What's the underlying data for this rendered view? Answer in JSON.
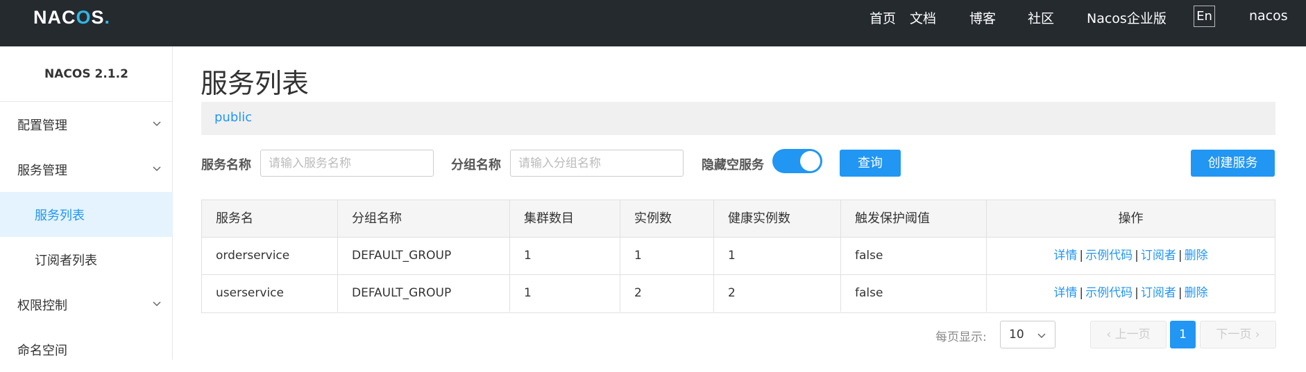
{
  "brand": {
    "logo_text_main": "NAC",
    "logo_text_mid": "O",
    "logo_text_end": "S",
    "logo_dot": "."
  },
  "topnav": {
    "items": [
      "首页",
      "文档",
      "博客",
      "社区",
      "Nacos企业版"
    ],
    "lang": "En",
    "user": "nacos"
  },
  "sidebar": {
    "version": "NACOS 2.1.2",
    "items": [
      {
        "label": "配置管理",
        "expandable": true
      },
      {
        "label": "服务管理",
        "expandable": true
      },
      {
        "label": "服务列表",
        "active": true
      },
      {
        "label": "订阅者列表"
      },
      {
        "label": "权限控制",
        "expandable": true
      },
      {
        "label": "命名空间"
      }
    ]
  },
  "page": {
    "title": "服务列表",
    "namespace": "public"
  },
  "filters": {
    "service_name_label": "服务名称",
    "service_name_placeholder": "请输入服务名称",
    "group_name_label": "分组名称",
    "group_name_placeholder": "请输入分组名称",
    "hide_empty_label": "隐藏空服务",
    "hide_empty_on": true,
    "query_label": "查询",
    "create_label": "创建服务"
  },
  "table": {
    "headers": [
      "服务名",
      "分组名称",
      "集群数目",
      "实例数",
      "健康实例数",
      "触发保护阈值",
      "操作"
    ],
    "rows": [
      [
        "orderservice",
        "DEFAULT_GROUP",
        "1",
        "1",
        "1",
        "false"
      ],
      [
        "userservice",
        "DEFAULT_GROUP",
        "1",
        "2",
        "2",
        "false"
      ]
    ],
    "actions": [
      "详情",
      "示例代码",
      "订阅者",
      "删除"
    ],
    "action_separator": "|"
  },
  "pagination": {
    "page_size_label": "每页显示:",
    "page_size": "10",
    "prev_label": "上一页",
    "next_label": "下一页",
    "current_page": "1"
  },
  "colors": {
    "accent": "#2196f3",
    "header_bg": "#252a2f",
    "logo_accent": "#2eb7e6"
  }
}
